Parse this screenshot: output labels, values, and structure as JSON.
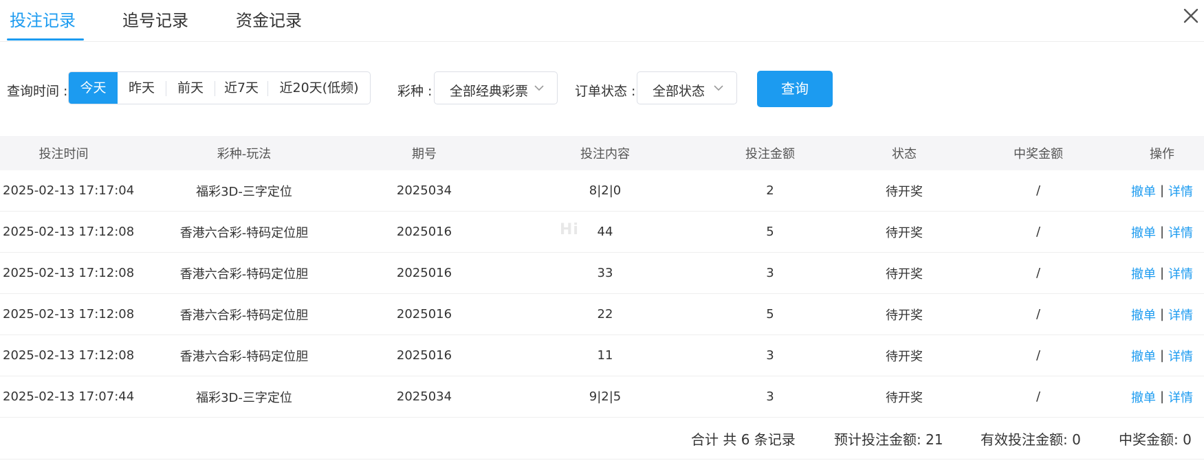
{
  "tabs": [
    {
      "label": "投注记录",
      "active": true
    },
    {
      "label": "追号记录",
      "active": false
    },
    {
      "label": "资金记录",
      "active": false
    }
  ],
  "close_icon": "close-icon",
  "filters": {
    "time_label": "查询时间 :",
    "date_options": [
      "今天",
      "昨天",
      "前天",
      "近7天",
      "近20天(低频)"
    ],
    "date_selected": "今天",
    "lottery_label": "彩种 :",
    "lottery_value": "全部经典彩票",
    "status_label": "订单状态 :",
    "status_value": "全部状态",
    "query_button": "查询"
  },
  "table": {
    "columns": [
      "投注时间",
      "彩种-玩法",
      "期号",
      "投注内容",
      "投注金额",
      "状态",
      "中奖金额",
      "操作"
    ],
    "rows": [
      {
        "time": "2025-02-13 17:17:04",
        "game": "福彩3D-三字定位",
        "period": "2025034",
        "content": "8|2|0",
        "amount": "2",
        "status": "待开奖",
        "prize": "/",
        "cancel": "撤单",
        "sep": "|",
        "detail": "详情"
      },
      {
        "time": "2025-02-13 17:12:08",
        "game": "香港六合彩-特码定位胆",
        "period": "2025016",
        "content": "44",
        "amount": "5",
        "status": "待开奖",
        "prize": "/",
        "cancel": "撤单",
        "sep": "|",
        "detail": "详情"
      },
      {
        "time": "2025-02-13 17:12:08",
        "game": "香港六合彩-特码定位胆",
        "period": "2025016",
        "content": "33",
        "amount": "3",
        "status": "待开奖",
        "prize": "/",
        "cancel": "撤单",
        "sep": "|",
        "detail": "详情"
      },
      {
        "time": "2025-02-13 17:12:08",
        "game": "香港六合彩-特码定位胆",
        "period": "2025016",
        "content": "22",
        "amount": "5",
        "status": "待开奖",
        "prize": "/",
        "cancel": "撤单",
        "sep": "|",
        "detail": "详情"
      },
      {
        "time": "2025-02-13 17:12:08",
        "game": "香港六合彩-特码定位胆",
        "period": "2025016",
        "content": "11",
        "amount": "3",
        "status": "待开奖",
        "prize": "/",
        "cancel": "撤单",
        "sep": "|",
        "detail": "详情"
      },
      {
        "time": "2025-02-13 17:07:44",
        "game": "福彩3D-三字定位",
        "period": "2025034",
        "content": "9|2|5",
        "amount": "3",
        "status": "待开奖",
        "prize": "/",
        "cancel": "撤单",
        "sep": "|",
        "detail": "详情"
      }
    ]
  },
  "summary": {
    "total": "合计 共 6 条记录",
    "expected": "预计投注金额: 21",
    "valid": "有效投注金额: 0",
    "prize": "中奖金额: 0"
  },
  "colors": {
    "accent": "#1c9bf0"
  }
}
